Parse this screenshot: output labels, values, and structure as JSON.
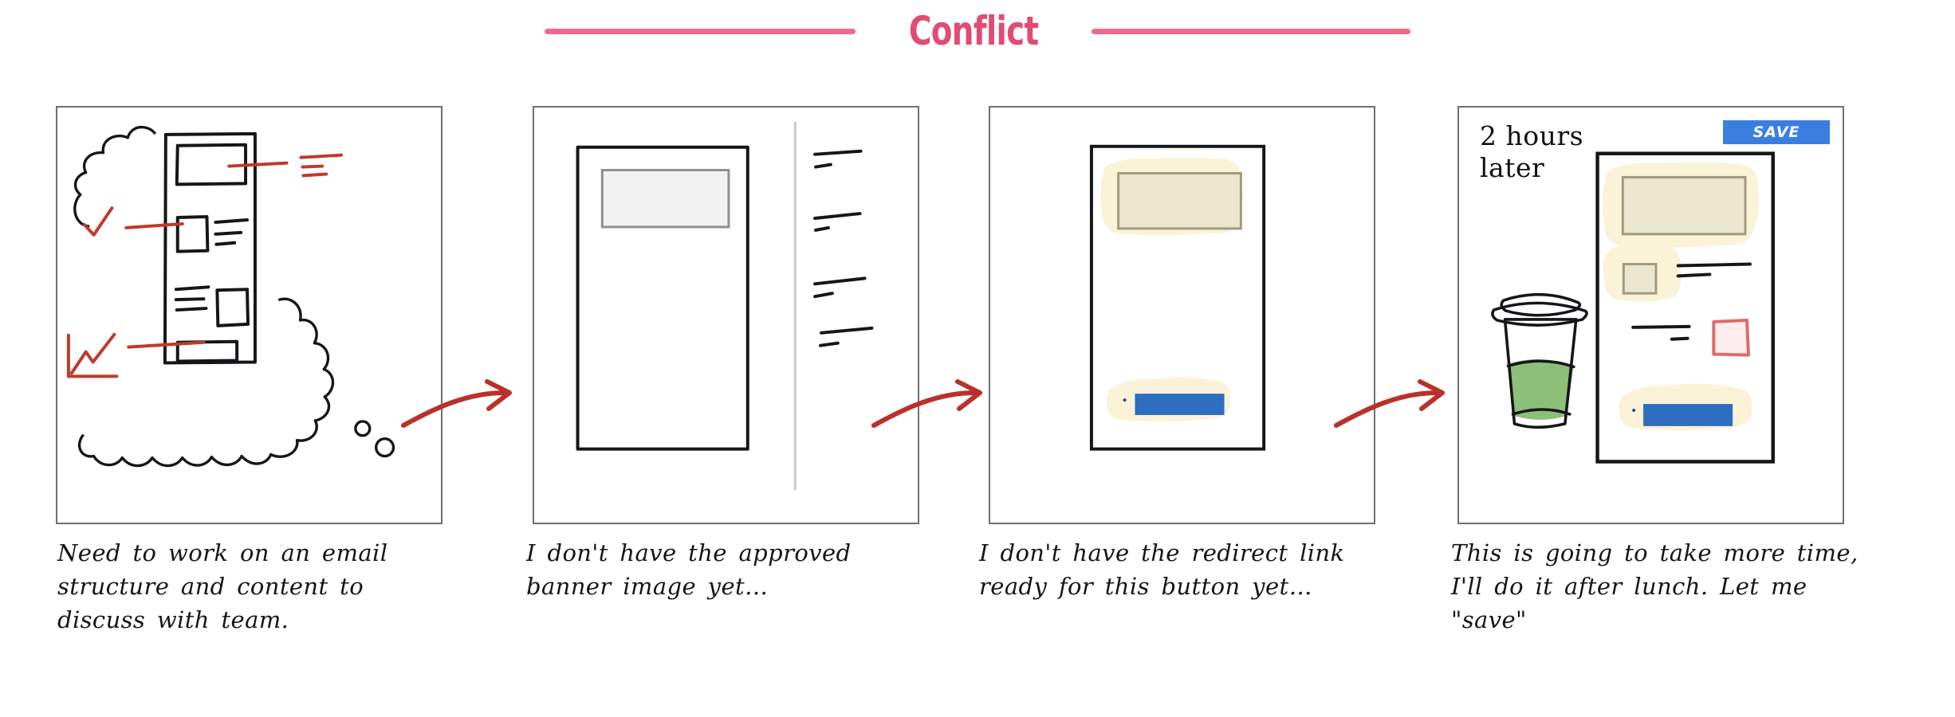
{
  "header": {
    "title": "Conflict",
    "accent_color": "#e14b74",
    "rule_color": "#ec6b8c"
  },
  "colors": {
    "arrow_red": "#b8312a",
    "annotation_red": "#c0392b",
    "highlight_cream": "#faf3d8",
    "banner_beige": "#ebe6ce",
    "cta_blue": "#2e6dbf",
    "save_blue": "#3a7fe0",
    "coffee_green": "#8cbf78",
    "block_pink": "#de6b6b",
    "panel_border": "#6f6f6f",
    "sketch_black": "#16161a"
  },
  "panels": [
    {
      "id": "panel-1",
      "name": "thought-bubble-wireframe",
      "caption": "Need to work on an email structure and content to discuss with team.",
      "elements": {
        "thought_cloud": "thought-cloud-icon",
        "wireframe": "email-wireframe",
        "annotations": [
          "check-icon",
          "line-chart-icon",
          "text-lines-icon"
        ]
      }
    },
    {
      "id": "panel-2",
      "name": "email-editor-empty-banner",
      "caption": "I don't have the approved banner image yet…",
      "elements": {
        "canvas": "email-canvas",
        "placeholder": "banner-placeholder",
        "sidebar": "properties-sidebar"
      }
    },
    {
      "id": "panel-3",
      "name": "email-editor-button-no-link",
      "caption": "I don't have the redirect link ready for this button yet…",
      "elements": {
        "banner": "banner-block",
        "cta": "cta-button-block"
      }
    },
    {
      "id": "panel-4",
      "name": "email-editor-two-hours-later",
      "caption": "This is going to take more time, I'll do it after lunch. Let me \"save\"",
      "time_note": "2 hours\nlater",
      "save_button_label": "SAVE",
      "elements": {
        "coffee": "coffee-cup-icon",
        "banner": "banner-block",
        "image_block": "image-block",
        "text_lines": "text-lines",
        "pink_block": "pink-block",
        "cta": "cta-button-block"
      }
    }
  ],
  "arrows": [
    {
      "name": "arrow-panel-1-to-2"
    },
    {
      "name": "arrow-panel-2-to-3"
    },
    {
      "name": "arrow-panel-3-to-4"
    }
  ]
}
